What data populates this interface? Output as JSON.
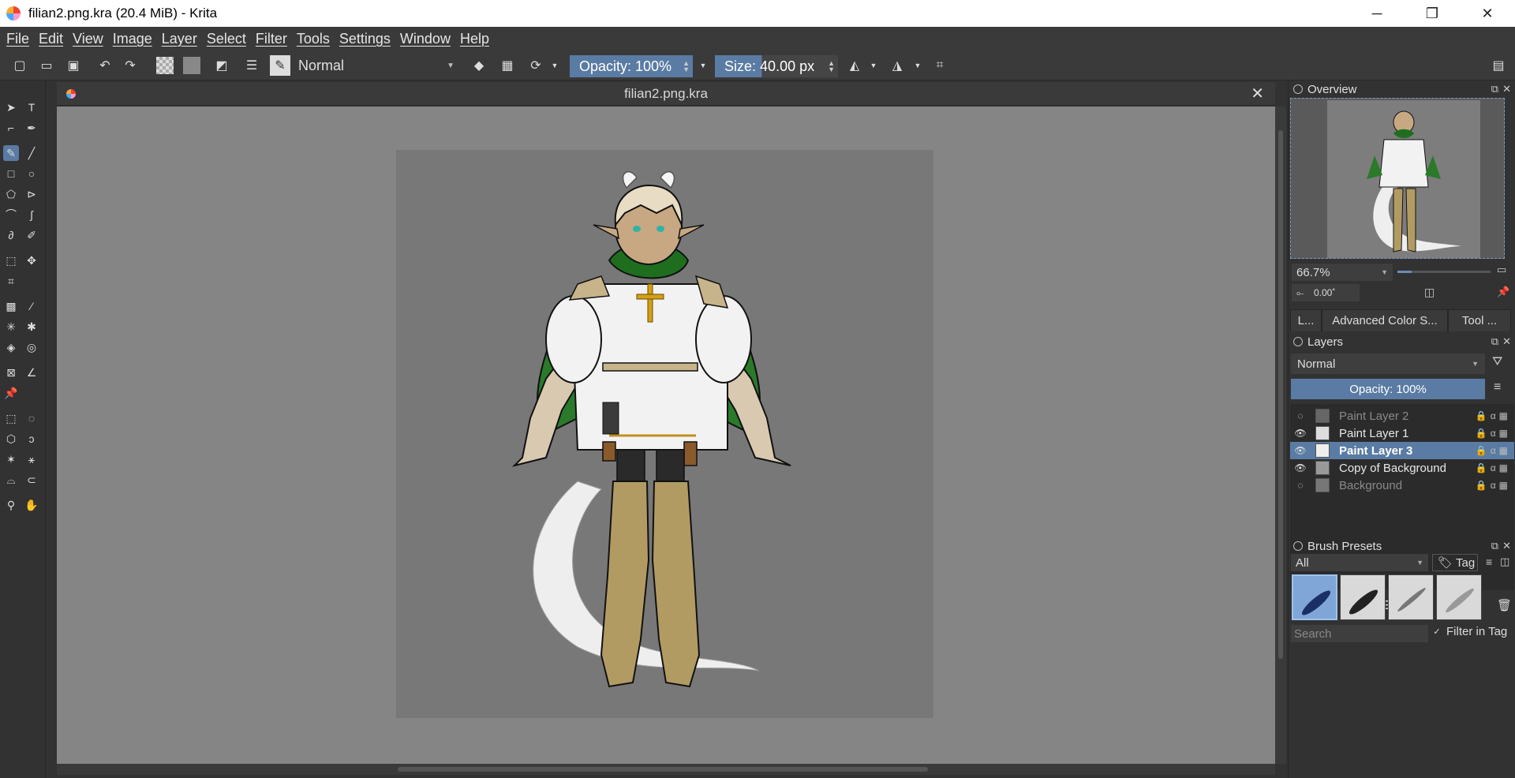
{
  "window": {
    "title": "filian2.png.kra (20.4 MiB)  - Krita",
    "minimize": "─",
    "maximize": "❐",
    "close": "✕"
  },
  "menu": [
    "File",
    "Edit",
    "View",
    "Image",
    "Layer",
    "Select",
    "Filter",
    "Tools",
    "Settings",
    "Window",
    "Help"
  ],
  "toolbar": {
    "blend_mode": "Normal",
    "opacity_label": "Opacity: 100%",
    "opacity_value": 1.0,
    "size_label": "Size:",
    "size_value": "40.00 px"
  },
  "document": {
    "tab_title": "filian2.png.kra",
    "close": "✕"
  },
  "overview": {
    "title": "Overview",
    "zoom": "66.7%",
    "rotation": "0.00˚"
  },
  "dock_tabs": [
    "L...",
    "Advanced Color S...",
    "Tool ..."
  ],
  "layers": {
    "title": "Layers",
    "blend_mode": "Normal",
    "opacity_label": "Opacity:  100%",
    "items": [
      {
        "name": "Paint Layer 2",
        "visible": false,
        "selected": false
      },
      {
        "name": "Paint Layer 1",
        "visible": true,
        "selected": false
      },
      {
        "name": "Paint Layer 3",
        "visible": true,
        "selected": true
      },
      {
        "name": "Copy of Background",
        "visible": true,
        "selected": false
      },
      {
        "name": "Background",
        "visible": false,
        "selected": false
      }
    ]
  },
  "brush_presets": {
    "title": "Brush Presets",
    "filter": "All",
    "tag_label": "Tag",
    "search_placeholder": "Search",
    "filter_in_tag": "Filter in Tag"
  },
  "colors": {
    "accent": "#5a7ba3",
    "canvas_bg": "#858585",
    "artboard": "#787878"
  }
}
